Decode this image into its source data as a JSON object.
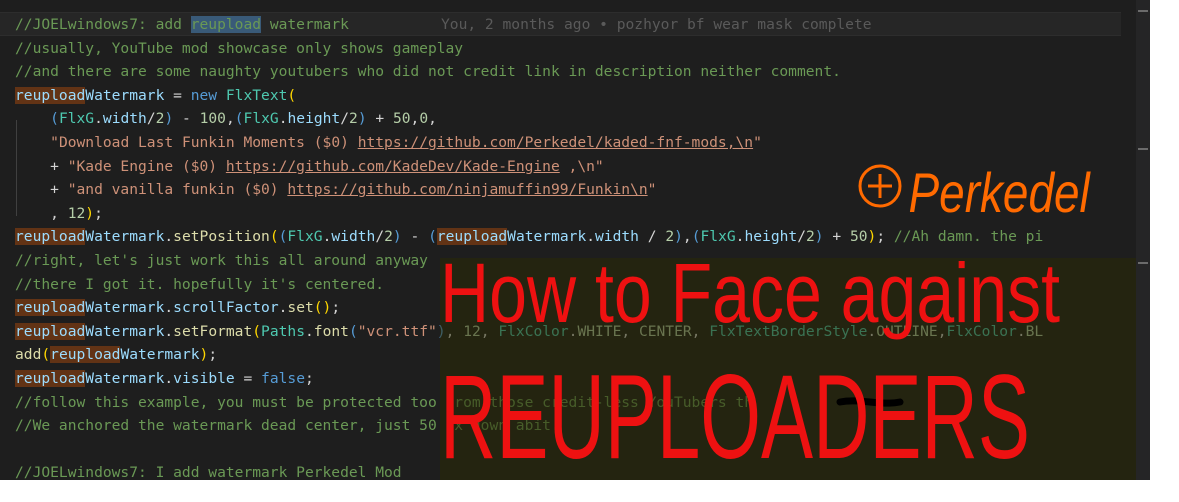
{
  "editor": {
    "blame_annotation": "You, 2 months ago • pozhyor bf wear mask complete",
    "lines": [
      [
        {
          "c": "cm",
          "t": "//JOELwindows7: add "
        },
        {
          "c": "cm hl-sel",
          "t": "reupload"
        },
        {
          "c": "cm",
          "t": " watermark"
        }
      ],
      [
        {
          "c": "cm",
          "t": "//usually, YouTube mod showcase only shows gameplay"
        }
      ],
      [
        {
          "c": "cm",
          "t": "//and there are some naughty youtubers who did not credit link in description neither comment."
        }
      ],
      [
        {
          "c": "var hl-find",
          "t": "reupload"
        },
        {
          "c": "var",
          "t": "Watermark"
        },
        {
          "c": "pu",
          "t": " = "
        },
        {
          "c": "kw",
          "t": "new"
        },
        {
          "c": "pu",
          "t": " "
        },
        {
          "c": "ty",
          "t": "FlxText"
        },
        {
          "c": "bracket",
          "t": "("
        }
      ],
      [
        {
          "c": "pu",
          "t": "    "
        },
        {
          "c": "kw",
          "t": "("
        },
        {
          "c": "ty",
          "t": "FlxG"
        },
        {
          "c": "pu",
          "t": "."
        },
        {
          "c": "var",
          "t": "width"
        },
        {
          "c": "pu",
          "t": "/"
        },
        {
          "c": "num",
          "t": "2"
        },
        {
          "c": "kw",
          "t": ")"
        },
        {
          "c": "pu",
          "t": " - "
        },
        {
          "c": "num",
          "t": "100"
        },
        {
          "c": "pu",
          "t": ","
        },
        {
          "c": "kw",
          "t": "("
        },
        {
          "c": "ty",
          "t": "FlxG"
        },
        {
          "c": "pu",
          "t": "."
        },
        {
          "c": "var",
          "t": "height"
        },
        {
          "c": "pu",
          "t": "/"
        },
        {
          "c": "num",
          "t": "2"
        },
        {
          "c": "kw",
          "t": ")"
        },
        {
          "c": "pu",
          "t": " + "
        },
        {
          "c": "num",
          "t": "50"
        },
        {
          "c": "pu",
          "t": ","
        },
        {
          "c": "num",
          "t": "0"
        },
        {
          "c": "pu",
          "t": ","
        }
      ],
      [
        {
          "c": "pu",
          "t": "    "
        },
        {
          "c": "str",
          "t": "\"Download Last Funkin Moments ($0) "
        },
        {
          "c": "url",
          "t": "https://github.com/Perkedel/kaded-fnf-mods,\\n"
        },
        {
          "c": "str",
          "t": "\""
        }
      ],
      [
        {
          "c": "pu",
          "t": "    + "
        },
        {
          "c": "str",
          "t": "\"Kade Engine ($0) "
        },
        {
          "c": "url",
          "t": "https://github.com/KadeDev/Kade-Engine"
        },
        {
          "c": "str",
          "t": " ,\\n\""
        }
      ],
      [
        {
          "c": "pu",
          "t": "    + "
        },
        {
          "c": "str",
          "t": "\"and vanilla funkin ($0) "
        },
        {
          "c": "url",
          "t": "https://github.com/ninjamuffin99/Funkin\\n"
        },
        {
          "c": "str",
          "t": "\""
        }
      ],
      [
        {
          "c": "pu",
          "t": "    , "
        },
        {
          "c": "num",
          "t": "12"
        },
        {
          "c": "bracket",
          "t": ")"
        },
        {
          "c": "pu",
          "t": ";"
        }
      ],
      [
        {
          "c": "var hl-find",
          "t": "reupload"
        },
        {
          "c": "var",
          "t": "Watermark"
        },
        {
          "c": "pu",
          "t": "."
        },
        {
          "c": "fn",
          "t": "setPosition"
        },
        {
          "c": "bracket",
          "t": "("
        },
        {
          "c": "kw",
          "t": "("
        },
        {
          "c": "ty",
          "t": "FlxG"
        },
        {
          "c": "pu",
          "t": "."
        },
        {
          "c": "var",
          "t": "width"
        },
        {
          "c": "pu",
          "t": "/"
        },
        {
          "c": "num",
          "t": "2"
        },
        {
          "c": "kw",
          "t": ")"
        },
        {
          "c": "pu",
          "t": " - "
        },
        {
          "c": "kw",
          "t": "("
        },
        {
          "c": "var hl-find",
          "t": "reupload"
        },
        {
          "c": "var",
          "t": "Watermark"
        },
        {
          "c": "pu",
          "t": "."
        },
        {
          "c": "var",
          "t": "width"
        },
        {
          "c": "pu",
          "t": " / "
        },
        {
          "c": "num",
          "t": "2"
        },
        {
          "c": "kw",
          "t": ")"
        },
        {
          "c": "pu",
          "t": ","
        },
        {
          "c": "kw",
          "t": "("
        },
        {
          "c": "ty",
          "t": "FlxG"
        },
        {
          "c": "pu",
          "t": "."
        },
        {
          "c": "var",
          "t": "height"
        },
        {
          "c": "pu",
          "t": "/"
        },
        {
          "c": "num",
          "t": "2"
        },
        {
          "c": "kw",
          "t": ")"
        },
        {
          "c": "pu",
          "t": " + "
        },
        {
          "c": "num",
          "t": "50"
        },
        {
          "c": "bracket",
          "t": ")"
        },
        {
          "c": "pu",
          "t": "; "
        },
        {
          "c": "cm",
          "t": "//Ah damn. the pi"
        }
      ],
      [
        {
          "c": "cm",
          "t": "//right, let's just work this all around anyway"
        }
      ],
      [
        {
          "c": "cm",
          "t": "//there I got it. hopefully it's centered."
        }
      ],
      [
        {
          "c": "var hl-find",
          "t": "reupload"
        },
        {
          "c": "var",
          "t": "Watermark"
        },
        {
          "c": "pu",
          "t": "."
        },
        {
          "c": "var",
          "t": "scrollFactor"
        },
        {
          "c": "pu",
          "t": "."
        },
        {
          "c": "fn",
          "t": "set"
        },
        {
          "c": "bracket",
          "t": "()"
        },
        {
          "c": "pu",
          "t": ";"
        }
      ],
      [
        {
          "c": "var hl-find",
          "t": "reupload"
        },
        {
          "c": "var",
          "t": "Watermark"
        },
        {
          "c": "pu",
          "t": "."
        },
        {
          "c": "fn",
          "t": "setFormat"
        },
        {
          "c": "bracket",
          "t": "("
        },
        {
          "c": "ty",
          "t": "Paths"
        },
        {
          "c": "pu",
          "t": "."
        },
        {
          "c": "fn",
          "t": "font"
        },
        {
          "c": "kw",
          "t": "("
        },
        {
          "c": "str",
          "t": "\"vcr.ttf\""
        },
        {
          "c": "kw",
          "t": ")"
        },
        {
          "c": "pu",
          "t": ", "
        },
        {
          "c": "num",
          "t": "12"
        },
        {
          "c": "pu",
          "t": ", "
        },
        {
          "c": "ty",
          "t": "FlxColor"
        },
        {
          "c": "pu",
          "t": "."
        },
        {
          "c": "num",
          "t": "WHITE"
        },
        {
          "c": "pu",
          "t": ", "
        },
        {
          "c": "num",
          "t": "CENTER"
        },
        {
          "c": "pu",
          "t": ", "
        },
        {
          "c": "ty",
          "t": "FlxTextBorderStyle"
        },
        {
          "c": "pu",
          "t": "."
        },
        {
          "c": "num",
          "t": "OUTLINE"
        },
        {
          "c": "pu",
          "t": ","
        },
        {
          "c": "ty",
          "t": "FlxColor"
        },
        {
          "c": "pu",
          "t": "."
        },
        {
          "c": "num",
          "t": "BL"
        }
      ],
      [
        {
          "c": "fn",
          "t": "add"
        },
        {
          "c": "bracket",
          "t": "("
        },
        {
          "c": "var hl-find",
          "t": "reupload"
        },
        {
          "c": "var",
          "t": "Watermark"
        },
        {
          "c": "bracket",
          "t": ")"
        },
        {
          "c": "pu",
          "t": ";"
        }
      ],
      [
        {
          "c": "var hl-find",
          "t": "reupload"
        },
        {
          "c": "var",
          "t": "Watermark"
        },
        {
          "c": "pu",
          "t": "."
        },
        {
          "c": "var",
          "t": "visible"
        },
        {
          "c": "pu",
          "t": " = "
        },
        {
          "c": "kw",
          "t": "false"
        },
        {
          "c": "pu",
          "t": ";"
        }
      ],
      [
        {
          "c": "cm",
          "t": "//follow this example, you must be protected too from those credit-less YouTubers th"
        }
      ],
      [
        {
          "c": "cm",
          "t": "//We anchored the watermark dead center, just 50 px down abit."
        }
      ],
      [],
      [
        {
          "c": "cm",
          "t": "//JOELwindows7: I add watermark Perkedel Mod"
        }
      ]
    ]
  },
  "overlay": {
    "logo_text": "Perkedel",
    "headline_line1": "How to Face against",
    "headline_line2": "REUPLOADERS",
    "colors": {
      "logo": "#ff6a00",
      "headline": "#ee1111",
      "dim_box": "#2a2a05"
    }
  },
  "theme": {
    "editor_bg": "#1e1e1e",
    "comment": "#6a9955",
    "variable": "#9cdcfe",
    "type": "#4ec9b0",
    "keyword": "#569cd6",
    "function": "#dcdcaa",
    "string": "#ce9178",
    "number": "#b5cea8"
  }
}
